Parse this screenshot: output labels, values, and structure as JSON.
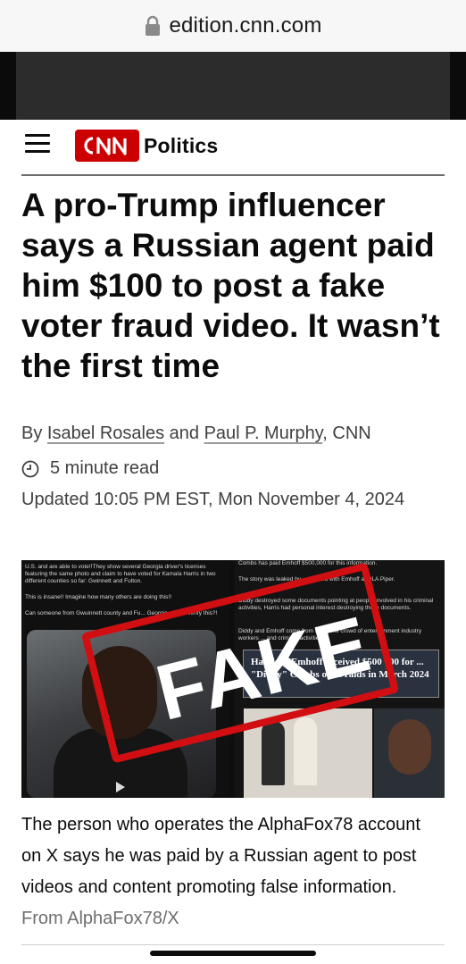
{
  "browser": {
    "url": "edition.cnn.com"
  },
  "header": {
    "brand": "CNN",
    "section": "Politics"
  },
  "article": {
    "headline": "A pro-Trump influencer says a Russian agent paid him $100 to post a fake voter fraud video. It wasn’t the first time",
    "byline_prefix": "By",
    "author_1": "Isabel Rosales",
    "byline_and": "and",
    "author_2": "Paul P. Murphy",
    "byline_outlet": ", CNN",
    "read_time": "5 minute read",
    "updated": "Updated 10:05 PM EST, Mon November 4, 2024"
  },
  "image": {
    "stamp_text": "FAKE",
    "left_text_1": "U.S. and are able to vote!!They show several Georgia driver's licenses featuring the same photo and claim to have voted for Kamala Harris in two different counties so far: Gwinnett and Fulton.",
    "left_text_2": "This is insane!! Imagine how many others are doing this!!",
    "left_text_3": "Can someone from Gwuinnett county and Fu... Georgia please verify this?!",
    "right_text_1": "Combs has paid Emhoff $500,000 for this information.",
    "right_text_2": "The story was leaked by ... worked with Emhoff at DLA Piper.",
    "right_text_3": "Diddy destroyed some documents pointing at people involved in his criminal activities, Harris had personal interest destroying these documents.",
    "right_text_4": "Diddy and Emhoff come from the same crowd of entertainment industry workers ... and criminal activities.",
    "banner_text": "Harris ... Emhoff received $500 000 for ... \"Diddy\" Combs on ... raids in March 2024"
  },
  "caption": {
    "text": "The person who operates the AlphaFox78 account on X says he was paid by a Russian agent to post videos and content promoting false information.",
    "credit": "From AlphaFox78/X"
  },
  "colors": {
    "brand_red": "#cc0000",
    "stamp_red": "#d10f12",
    "text": "#0c0c0c",
    "muted": "#404040"
  }
}
